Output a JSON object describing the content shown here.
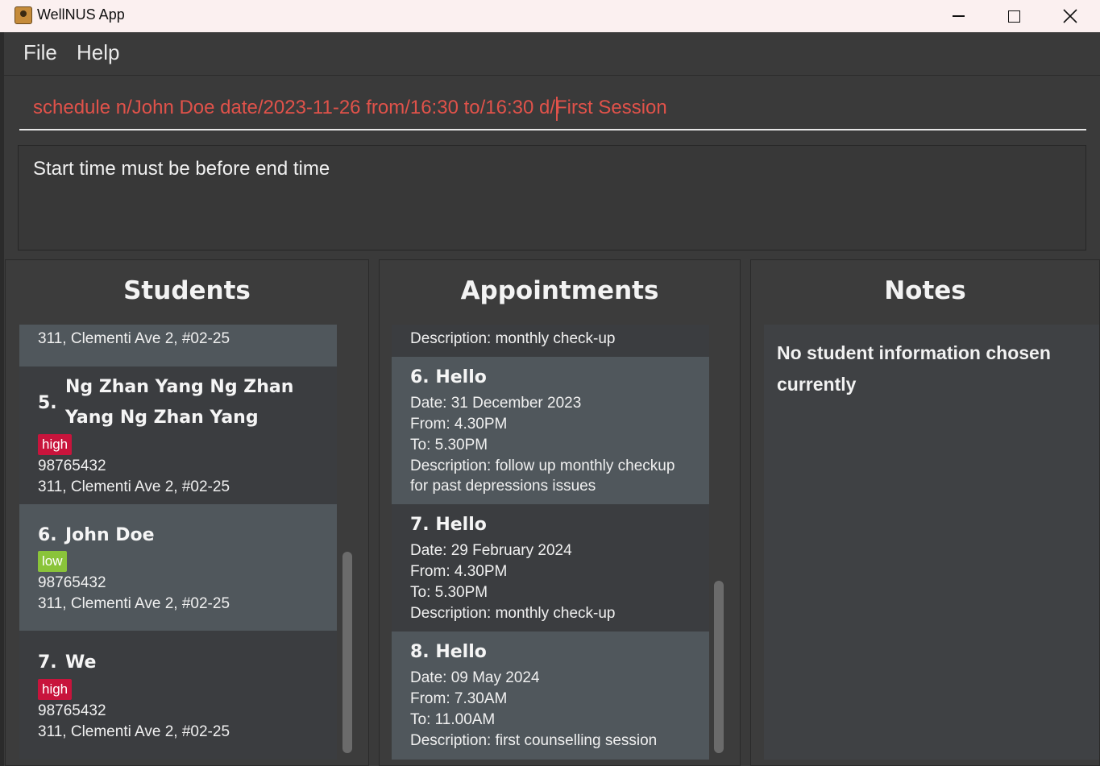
{
  "window": {
    "title": "WellNUS App"
  },
  "menu": {
    "file": "File",
    "help": "Help"
  },
  "command": {
    "value": "schedule n/John Doe date/2023-11-26 from/16:30 to/16:30 d/First Session"
  },
  "result": {
    "message": "Start time must be before end time"
  },
  "students": {
    "title": "Students",
    "partial_address": "311, Clementi Ave 2, #02-25",
    "items": [
      {
        "index": "5.",
        "name": "Ng Zhan Yang Ng Zhan Yang Ng Zhan Yang",
        "risk": "high",
        "phone": "98765432",
        "address": "311, Clementi Ave 2, #02-25"
      },
      {
        "index": "6.",
        "name": "John Doe",
        "risk": "low",
        "phone": "98765432",
        "address": "311, Clementi Ave 2, #02-25"
      },
      {
        "index": "7.",
        "name": "We",
        "risk": "high",
        "phone": "98765432",
        "address": "311, Clementi Ave 2, #02-25"
      }
    ]
  },
  "appointments": {
    "title": "Appointments",
    "partial_description": "Description: monthly check-up",
    "items": [
      {
        "title": "6.  Hello",
        "date": "Date: 31 December 2023",
        "from": "From: 4.30PM",
        "to": "To: 5.30PM",
        "description_1": "Description: follow up monthly checkup",
        "description_2": "for past depressions issues"
      },
      {
        "title": "7.  Hello",
        "date": "Date: 29 February 2024",
        "from": "From: 4.30PM",
        "to": "To: 5.30PM",
        "description_1": "Description: monthly check-up"
      },
      {
        "title": "8.  Hello",
        "date": "Date: 09 May 2024",
        "from": "From: 7.30AM",
        "to": "To: 11.00AM",
        "description_1": "Description: first counselling session"
      }
    ]
  },
  "notes": {
    "title": "Notes",
    "empty_message": "No student information chosen currently"
  },
  "icons": {
    "app": "app-icon",
    "minimize": "minimize-icon",
    "maximize": "maximize-icon",
    "close": "close-icon"
  },
  "colors": {
    "error_text": "#e0524a",
    "tag_high": "#c8143c",
    "tag_low": "#8ac43a",
    "card_light": "#50575c",
    "card_dark": "#3b3d40"
  }
}
